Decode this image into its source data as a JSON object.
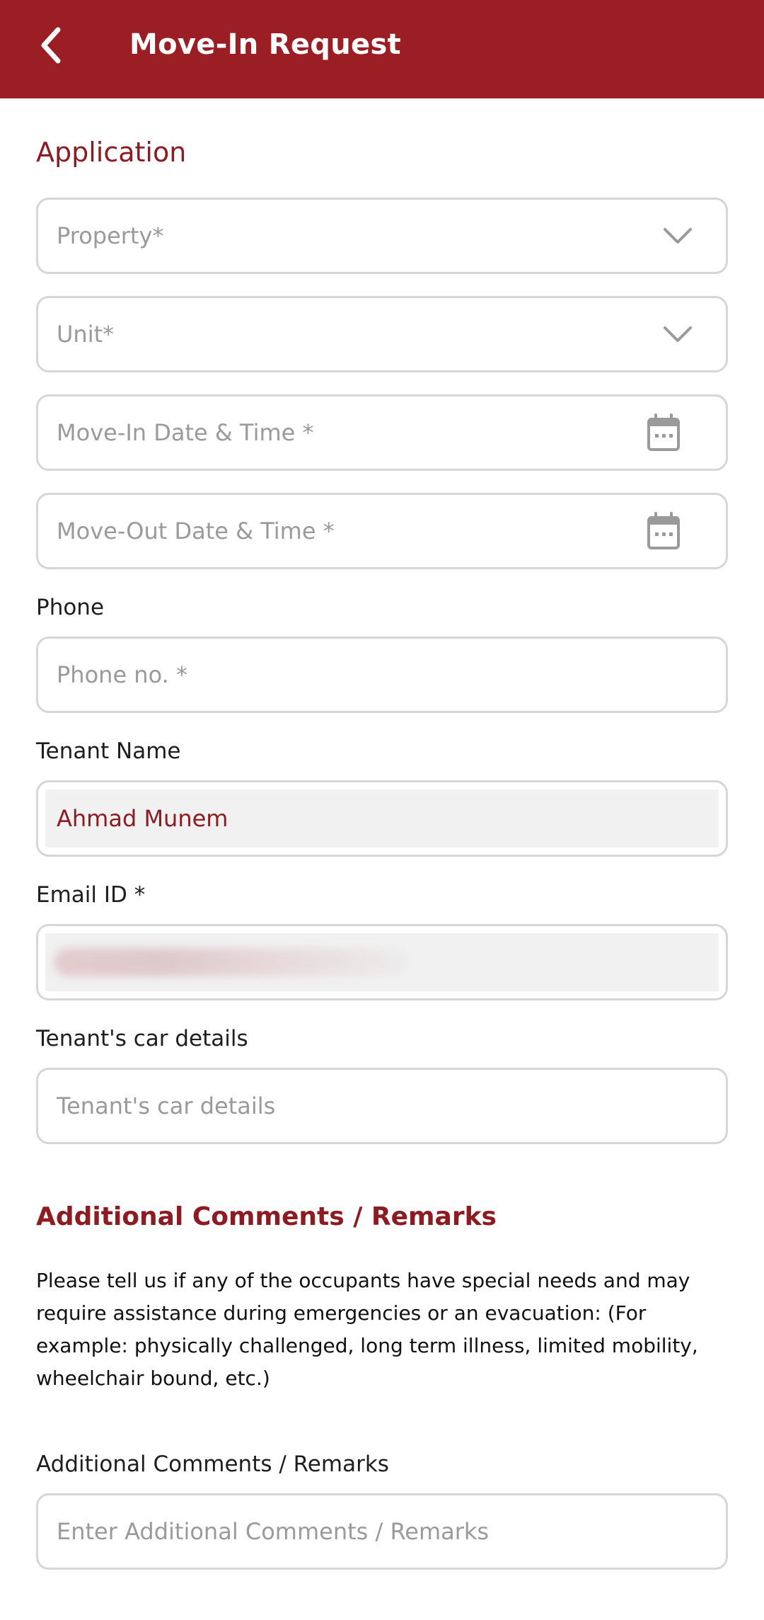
{
  "header": {
    "title": "Move-In Request",
    "bg_color": "#9b1e24"
  },
  "application": {
    "section_title": "Application",
    "property_placeholder": "Property*",
    "unit_placeholder": "Unit*",
    "move_in_placeholder": "Move-In Date & Time *",
    "move_out_placeholder": "Move-Out Date & Time *"
  },
  "phone": {
    "label": "Phone",
    "placeholder": "Phone no. *"
  },
  "tenant": {
    "label": "Tenant Name",
    "value": "Ahmad Munem"
  },
  "email": {
    "label": "Email ID *"
  },
  "car": {
    "label": "Tenant's car details",
    "placeholder": "Tenant's car details"
  },
  "additional": {
    "section_title": "Additional Comments / Remarks",
    "description": "Please tell us if any of the occupants have special needs and may require assistance during emergencies or an evacuation: (For example: physically challenged, long term illness, limited mobility, wheelchair bound, etc.)",
    "label": "Additional Comments / Remarks",
    "placeholder": "Enter Additional Comments / Remarks"
  },
  "icons": {
    "back": "chevron-left-icon",
    "dropdown": "chevron-down-icon",
    "calendar": "calendar-icon"
  },
  "colors": {
    "accent": "#8c1c22",
    "border": "#d6d6d6",
    "placeholder": "#9a9a9a",
    "readonly_fill": "#f1f1f1"
  }
}
